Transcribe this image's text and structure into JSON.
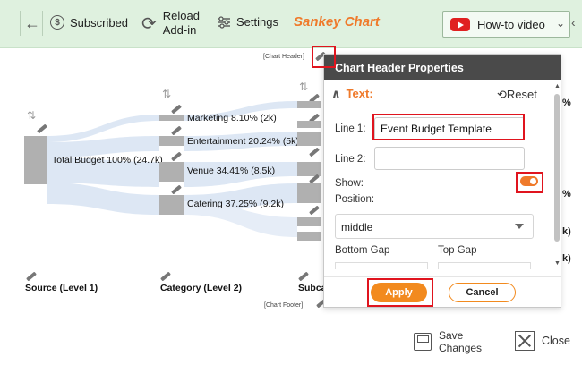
{
  "toolbar": {
    "subscribed_label": "Subscribed",
    "reload_line1": "Reload",
    "reload_line2": "Add-in",
    "settings_label": "Settings",
    "title": "Sankey Chart",
    "howto_label": "How-to video"
  },
  "chart": {
    "header_tag": "[Chart Header]",
    "footer_tag": "[Chart Footer]",
    "source_label": "Total Budget 100% (24.7k)",
    "categories": [
      {
        "label": "Marketing 8.10% (2k)"
      },
      {
        "label": "Entertainment 20.24% (5k)"
      },
      {
        "label": "Venue 34.41% (8.5k)"
      },
      {
        "label": "Catering 37.25% (9.2k)"
      }
    ],
    "levels": {
      "level1": "Source (Level 1)",
      "level2": "Category (Level 2)",
      "level3": "Subca"
    },
    "right_clip": [
      "%",
      "%",
      "k)",
      "k)"
    ]
  },
  "dialog": {
    "title": "Chart Header Properties",
    "section": "Text:",
    "reset_label": "Reset",
    "line1_label": "Line 1:",
    "line1_value": "Event Budget Template",
    "line2_label": "Line 2:",
    "line2_value": "",
    "show_label": "Show:",
    "show_value": "on",
    "position_label": "Position:",
    "position_value": "middle",
    "bottom_gap_label": "Bottom Gap",
    "top_gap_label": "Top Gap",
    "apply_label": "Apply",
    "cancel_label": "Cancel"
  },
  "bottombar": {
    "save_line1": "Save",
    "save_line2": "Changes",
    "close_label": "Close"
  },
  "colors": {
    "accent": "#ef7a2b",
    "toolbar_bg": "#dff1df",
    "highlight": "#e0141e",
    "flow": "#dde7f4",
    "node": "#b0b0b0"
  }
}
